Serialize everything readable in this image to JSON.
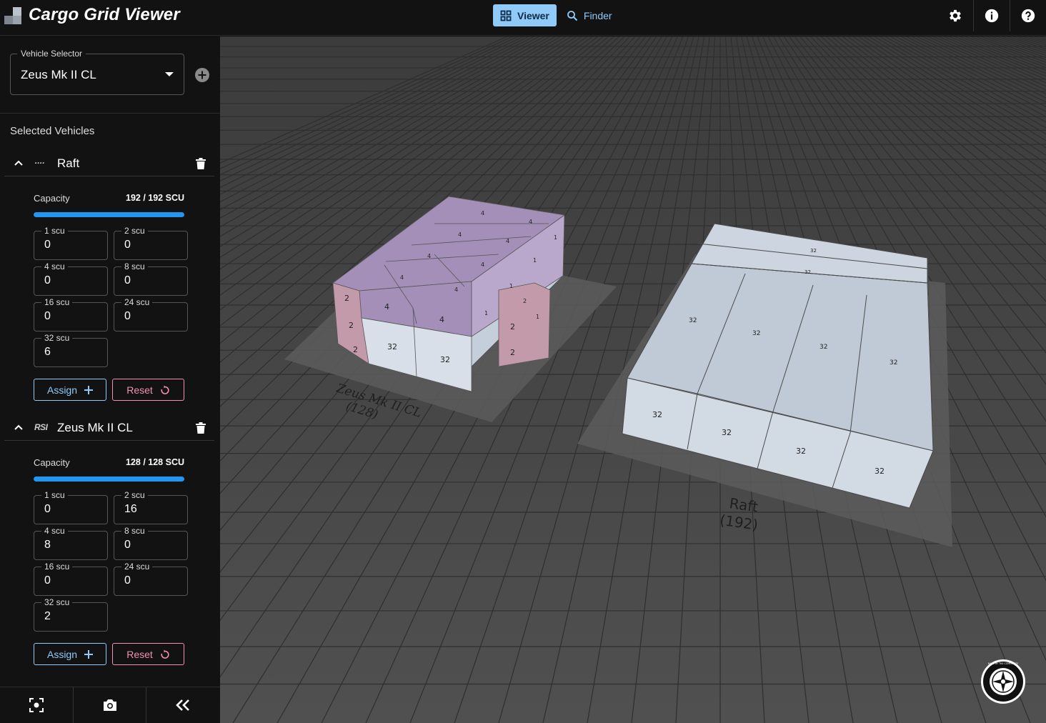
{
  "app": {
    "title": "Cargo Grid Viewer"
  },
  "nav": {
    "viewer": "Viewer",
    "finder": "Finder"
  },
  "vehicle_selector": {
    "legend": "Vehicle Selector",
    "value": "Zeus Mk II CL"
  },
  "selected_vehicles_title": "Selected Vehicles",
  "vehicles": [
    {
      "name": "Raft",
      "manufacturer": "····",
      "capacity_label": "Capacity",
      "capacity_text": "192 / 192 SCU",
      "capacity_fraction": 1.0,
      "fields": [
        {
          "label": "1 scu",
          "value": "0"
        },
        {
          "label": "2 scu",
          "value": "0"
        },
        {
          "label": "4 scu",
          "value": "0"
        },
        {
          "label": "8 scu",
          "value": "0"
        },
        {
          "label": "16 scu",
          "value": "0"
        },
        {
          "label": "24 scu",
          "value": "0"
        },
        {
          "label": "32 scu",
          "value": "6"
        }
      ],
      "assign_label": "Assign",
      "reset_label": "Reset"
    },
    {
      "name": "Zeus Mk II CL",
      "manufacturer": "RSI",
      "capacity_label": "Capacity",
      "capacity_text": "128 / 128 SCU",
      "capacity_fraction": 1.0,
      "fields": [
        {
          "label": "1 scu",
          "value": "0"
        },
        {
          "label": "2 scu",
          "value": "16"
        },
        {
          "label": "4 scu",
          "value": "8"
        },
        {
          "label": "8 scu",
          "value": "0"
        },
        {
          "label": "16 scu",
          "value": "0"
        },
        {
          "label": "24 scu",
          "value": "0"
        },
        {
          "label": "32 scu",
          "value": "2"
        }
      ],
      "assign_label": "Assign",
      "reset_label": "Reset"
    }
  ],
  "scene": {
    "zeus_label_name": "Zeus Mk II CL",
    "zeus_label_cap": "(128)",
    "raft_label_name": "Raft",
    "raft_label_cap": "(192)",
    "box_32": "32",
    "box_4": "4",
    "box_2": "2",
    "box_1": "1",
    "badge_text": "MADE BY THE COMMUNITY"
  },
  "colors": {
    "accent": "#90caf9",
    "progress": "#2196f3",
    "reset": "#f48fb1",
    "box_light": "#c5cfdb",
    "box_purple": "#a48fb9",
    "box_pink": "#c39aa9"
  }
}
